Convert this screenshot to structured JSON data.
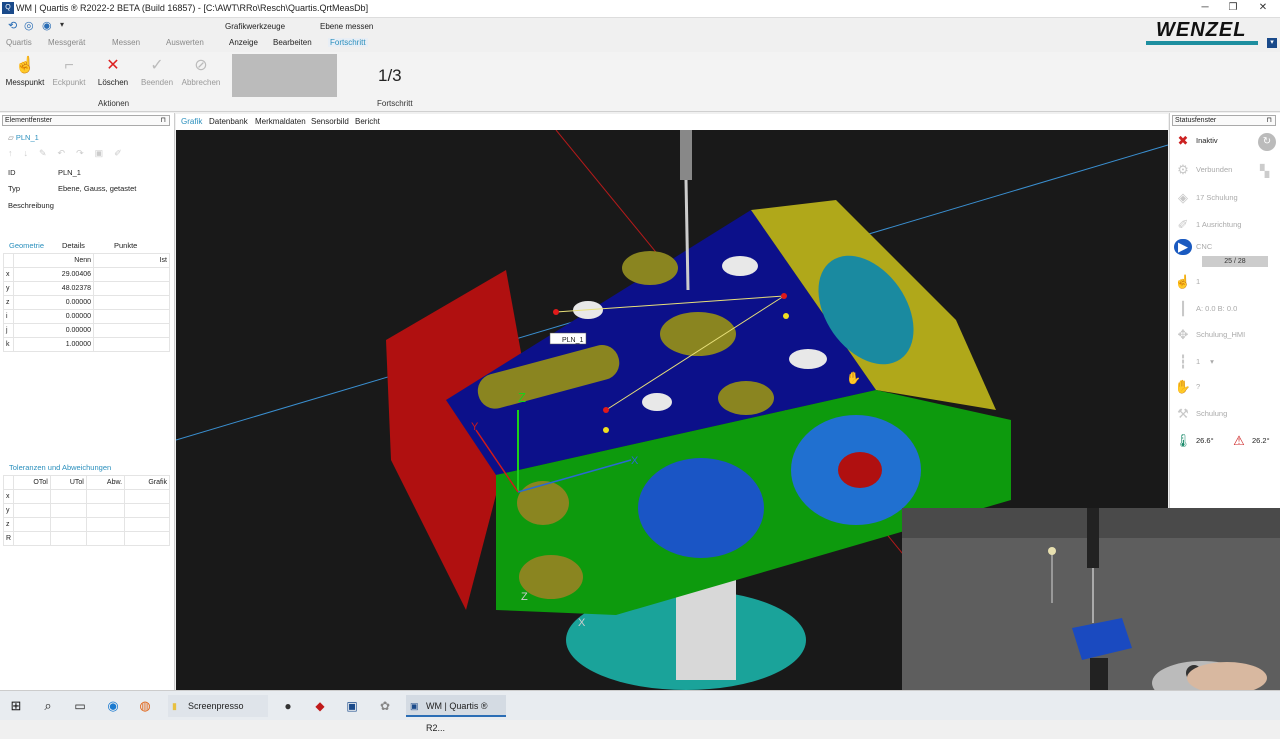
{
  "window": {
    "title": "WM | Quartis ® R2022-2 BETA (Build 16857) - [C:\\AWT\\RRo\\Resch\\Quartis.QrtMeasDb]"
  },
  "ribbon": {
    "context_headers": [
      "Grafikwerkzeuge",
      "Ebene messen"
    ],
    "tabs": [
      "Quartis",
      "Messgerät",
      "Messen",
      "Auswerten",
      "Anzeige",
      "Bearbeiten",
      "Fortschritt"
    ],
    "buttons": [
      "Messpunkt",
      "Eckpunkt",
      "Löschen",
      "Beenden",
      "Abbrechen"
    ],
    "group_label": "Aktionen",
    "progress_value": "1/3",
    "progress_label": "Fortschritt"
  },
  "brand": {
    "logo": "WENZEL",
    "accent": "#1e8fa0"
  },
  "element_panel": {
    "title": "Elementfenster",
    "element": "PLN_1",
    "id_label": "ID",
    "id_value": "PLN_1",
    "type_label": "Typ",
    "type_value": "Ebene, Gauss, getastet",
    "description_label": "Beschreibung",
    "subtabs": [
      "Geometrie",
      "Details",
      "Punkte"
    ],
    "col_nominal": "Nenn",
    "col_actual": "Ist",
    "rows": [
      {
        "name": "x",
        "value": "29.00406"
      },
      {
        "name": "y",
        "value": "48.02378"
      },
      {
        "name": "z",
        "value": "0.00000"
      },
      {
        "name": "i",
        "value": "0.00000"
      },
      {
        "name": "j",
        "value": "0.00000"
      },
      {
        "name": "k",
        "value": "1.00000"
      }
    ],
    "tolerances_title": "Toleranzen und Abweichungen",
    "tol_headers": [
      "OTol",
      "UTol",
      "Abw.",
      "Grafik"
    ],
    "tol_rows": [
      "x",
      "y",
      "z",
      "R"
    ]
  },
  "view_tabs": [
    "Grafik",
    "Datenbank",
    "Merkmaldaten",
    "Sensorbild",
    "Bericht"
  ],
  "viewport": {
    "plane_label": "PLN_1",
    "axis_x": "X",
    "axis_y": "Y",
    "axis_z": "Z"
  },
  "status_panel": {
    "title": "Statusfenster",
    "items": [
      "Inaktiv",
      "Verbunden",
      "17 Schulung",
      "1 Ausrichtung",
      "CNC",
      "25 / 28",
      "1",
      "A: 0.0 B: 0.0",
      "Schulung_HMI",
      "1",
      "?",
      "Schulung",
      "26.6°",
      "26.2°"
    ]
  },
  "taskbar": {
    "items": [
      "Screenpresso",
      "WM | Quartis ® R2..."
    ]
  }
}
